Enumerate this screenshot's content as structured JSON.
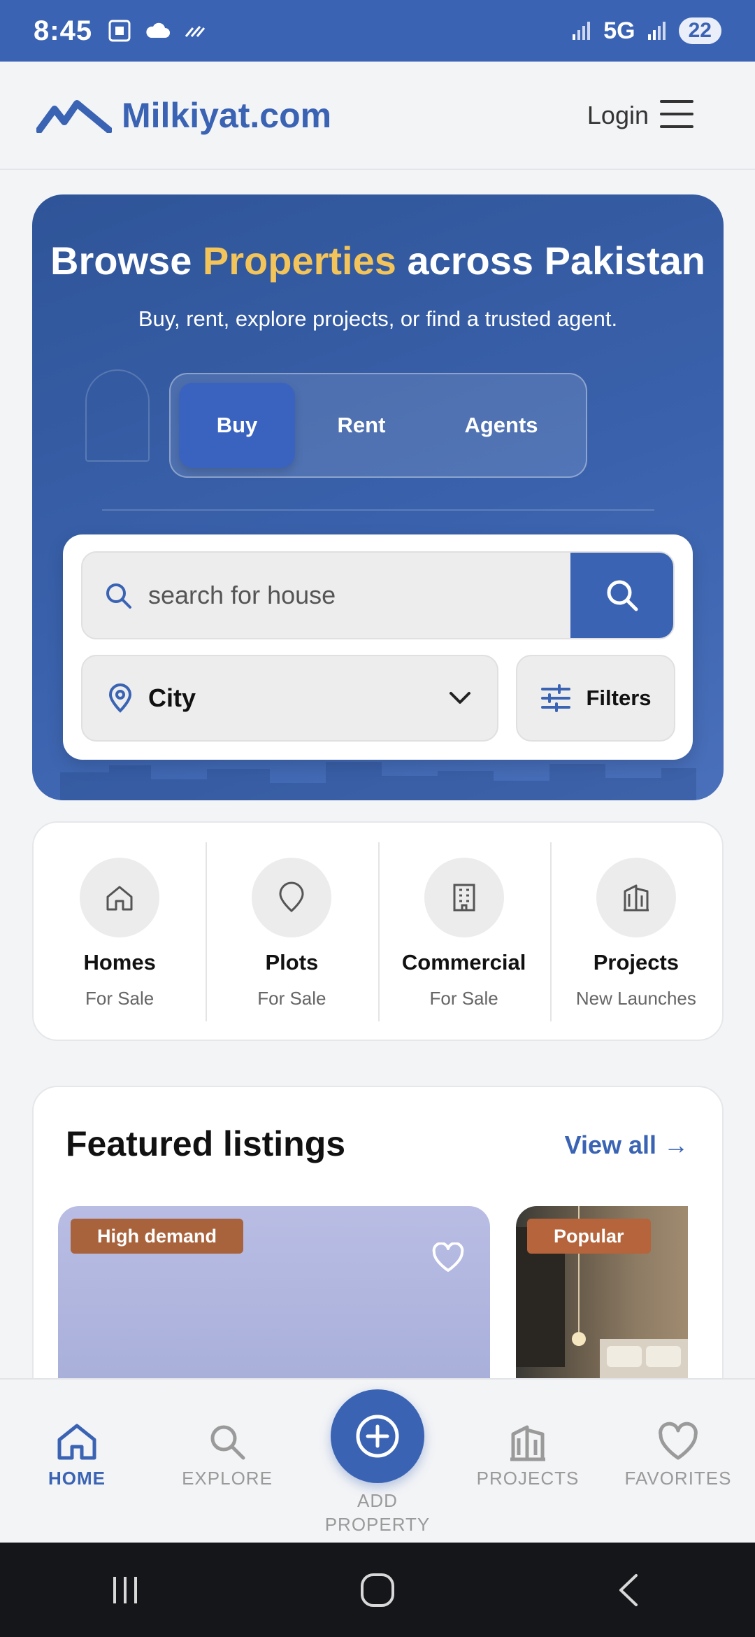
{
  "status_bar": {
    "time": "8:45",
    "network": "5G",
    "battery": "22"
  },
  "header": {
    "brand": "Milkiyat.com",
    "login": "Login"
  },
  "hero": {
    "title_part1": "Browse ",
    "title_highlight": "Properties",
    "title_part2": " across Pakistan",
    "subtitle": "Buy, rent, explore projects, or find a trusted agent.",
    "tabs": [
      {
        "label": "Buy",
        "active": true
      },
      {
        "label": "Rent",
        "active": false
      },
      {
        "label": "Agents",
        "active": false
      }
    ],
    "search_value": "search for house",
    "city_label": "City",
    "filters_label": "Filters"
  },
  "categories": [
    {
      "title": "Homes",
      "subtitle": "For Sale",
      "icon": "home-icon"
    },
    {
      "title": "Plots",
      "subtitle": "For Sale",
      "icon": "location-pin-icon"
    },
    {
      "title": "Commercial",
      "subtitle": "For Sale",
      "icon": "building-icon"
    },
    {
      "title": "Projects",
      "subtitle": "New Launches",
      "icon": "project-building-icon"
    }
  ],
  "featured": {
    "title": "Featured listings",
    "view_all": "View all →",
    "cards": [
      {
        "tag": "High demand"
      },
      {
        "tag": "Popular"
      }
    ]
  },
  "bottom_nav": {
    "home": "HOME",
    "explore": "EXPLORE",
    "add_line1": "ADD",
    "add_line2": "PROPERTY",
    "projects": "PROJECTS",
    "favorites": "FAVORITES"
  },
  "colors": {
    "primary": "#3a63b4",
    "gold": "#f2c45a",
    "tag": "#a9633c"
  }
}
